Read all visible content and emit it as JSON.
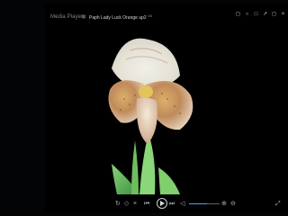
{
  "titlebar": {
    "app_title": "Media Player",
    "now_playing": "Paph Lady Luck Orange up2",
    "version": "V8"
  },
  "window_controls": [
    "◻",
    "○",
    "□",
    "↗",
    "◻",
    "×"
  ],
  "controls": {
    "shuffle": "↻",
    "repeat": "◇",
    "stop": "×",
    "prev": "⏮",
    "next": "⏭",
    "mute": "◁",
    "zoom_in": "⊕",
    "zoom_out": "⊖",
    "fullscreen": "⤢"
  },
  "colors": {
    "accent": "#45a7e8",
    "background": "#000000"
  }
}
